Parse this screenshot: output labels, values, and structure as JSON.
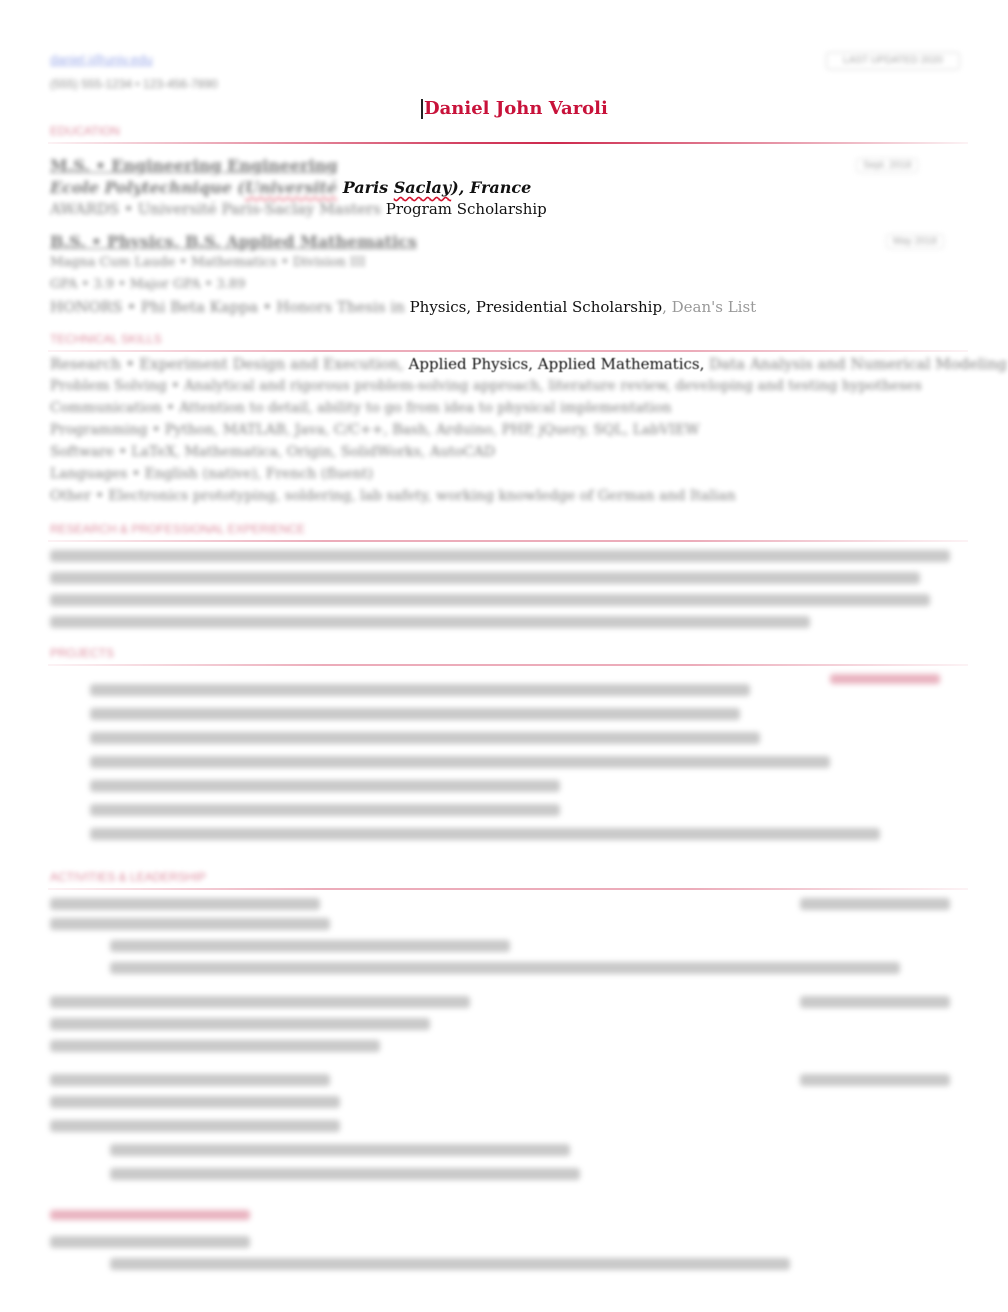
{
  "header": {
    "email": "daniel.j@univ.edu",
    "phone": "(555) 555-1234 • 123-456-7890",
    "corner_label": "LAST UPDATED 2020",
    "name": "Daniel John Varoli"
  },
  "education": {
    "heading": "EDUCATION",
    "entry1": {
      "degree": "M.S. • Engineering Engineering",
      "school_blurred": "Ecole Polytechnique (",
      "school_squiggle": "Université",
      "school_rest": " Paris ",
      "school_squiggle2": "Saclay",
      "school_end": "), France",
      "award_blurred": "AWARDS • Université Paris-Saclay Masters ",
      "award_visible": "Program Scholarship",
      "date": "Sept. 2018"
    },
    "entry2": {
      "degree": "B.S. • Physics, B.S. Applied Mathematics",
      "line2": "Magna Cum Laude • Mathematics • Division III",
      "line3": "GPA • 3.9 • Major GPA • 3.89",
      "award_blurred": "HONORS • Phi Beta Kappa • Honors Thesis in ",
      "award_visible": "Physics, Presidential Scholarship",
      "award_fade": ", Dean's List",
      "date": "May 2018"
    }
  },
  "skills": {
    "heading": "TECHNICAL SKILLS",
    "line1_blur": "Research • Experiment Design and Execution,",
    "line1_visible": " Applied Physics, Applied Mathematics,",
    "line1_fade": " Data Analysis and Numerical Modeling",
    "line2": "Problem Solving • Analytical and rigorous problem-solving approach, literature review, developing and testing hypotheses",
    "line3": "Communication • Attention to detail, ability to go from idea to physical implementation",
    "line4": "Programming • Python, MATLAB, Java, C/C++, Bash, Arduino, PHP, jQuery, SQL, LabVIEW",
    "line5": "Software • LaTeX, Mathematica, Origin, SolidWorks, AutoCAD",
    "line6": "Languages • English (native), French (fluent)",
    "line7": "Other • Electronics prototyping, soldering, lab safety, working knowledge of German and Italian"
  },
  "research": {
    "heading": "RESEARCH & PROFESSIONAL EXPERIENCE"
  },
  "projects": {
    "heading": "PROJECTS"
  },
  "activities": {
    "heading": "ACTIVITIES & LEADERSHIP"
  }
}
